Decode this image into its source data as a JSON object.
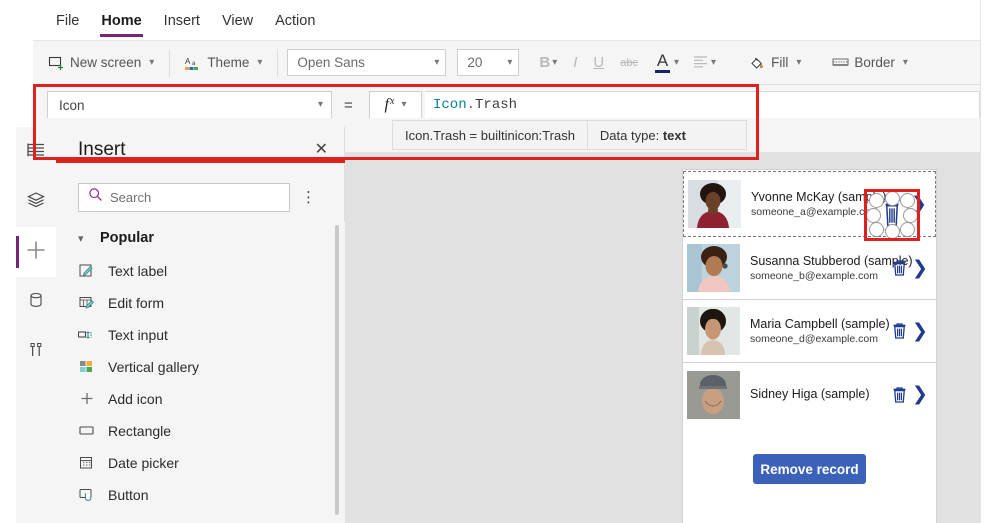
{
  "menu": {
    "items": [
      {
        "label": "File",
        "active": false
      },
      {
        "label": "Home",
        "active": true
      },
      {
        "label": "Insert",
        "active": false
      },
      {
        "label": "View",
        "active": false
      },
      {
        "label": "Action",
        "active": false
      }
    ]
  },
  "ribbon": {
    "new_screen": "New screen",
    "theme": "Theme",
    "font_family": "Open Sans",
    "font_size": "20",
    "bold": "B",
    "italic": "I",
    "underline": "U",
    "strikethrough": "abc",
    "font_color": "A",
    "align": "align",
    "fill": "Fill",
    "border": "Border",
    "caret": "⌄"
  },
  "formula_bar": {
    "property": "Icon",
    "equals": "=",
    "fx": "fx",
    "formula_identifier": "Icon",
    "formula_dot": ".",
    "formula_member": "Trash",
    "formula_full": "Icon.Trash",
    "intellisense_definition": "Icon.Trash  =  builtinicon:Trash",
    "intellisense_datatype_label": "Data type:",
    "intellisense_datatype_value": "text"
  },
  "rail": {
    "items": [
      {
        "name": "tree-view-icon",
        "selected": false
      },
      {
        "name": "layers-icon",
        "selected": false
      },
      {
        "name": "insert-plus-icon",
        "selected": true
      },
      {
        "name": "data-icon",
        "selected": false
      },
      {
        "name": "media-icon",
        "selected": false
      }
    ]
  },
  "insert_panel": {
    "title": "Insert",
    "close": "✕",
    "search_placeholder": "Search",
    "more_options": "⋮",
    "group": {
      "label": "Popular",
      "expanded": true,
      "items": [
        {
          "label": "Text label",
          "icon": "text-label-icon"
        },
        {
          "label": "Edit form",
          "icon": "edit-form-icon"
        },
        {
          "label": "Text input",
          "icon": "text-input-icon"
        },
        {
          "label": "Vertical gallery",
          "icon": "vertical-gallery-icon"
        },
        {
          "label": "Add icon",
          "icon": "add-icon"
        },
        {
          "label": "Rectangle",
          "icon": "rectangle-icon"
        },
        {
          "label": "Date picker",
          "icon": "date-picker-icon"
        },
        {
          "label": "Button",
          "icon": "button-icon"
        }
      ]
    }
  },
  "app_screen": {
    "gallery": [
      {
        "name": "Yvonne McKay (sample)",
        "email": "someone_a@example.com",
        "selected": true
      },
      {
        "name": "Susanna Stubberod (sample)",
        "email": "someone_b@example.com",
        "selected": false
      },
      {
        "name": "Maria Campbell (sample)",
        "email": "someone_d@example.com",
        "selected": false
      },
      {
        "name": "Sidney Higa (sample)",
        "email": "",
        "selected": false
      }
    ],
    "remove_button": "Remove record"
  },
  "colors": {
    "accent_purple": "#742774",
    "annotation_red": "#e02020",
    "button_blue": "#3b62b8",
    "chevron_navy": "#1f3a8f",
    "formula_identifier": "#0b8093",
    "formula_dot": "#c0399f"
  }
}
